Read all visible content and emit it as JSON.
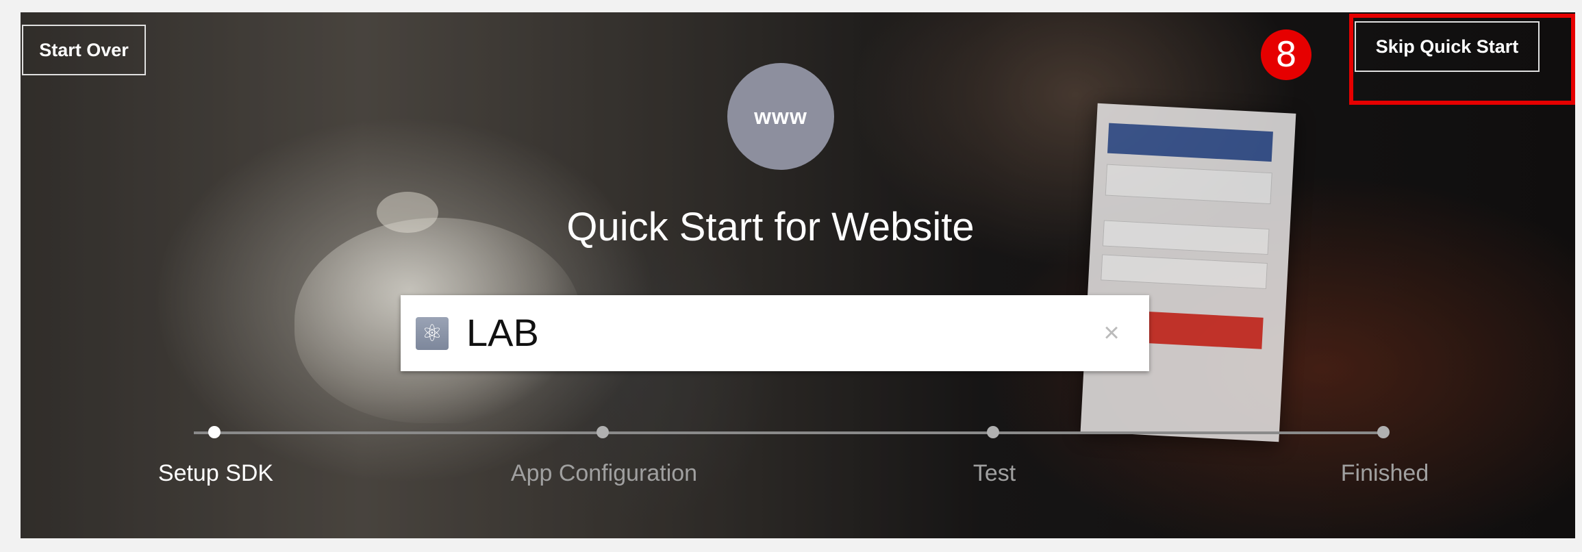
{
  "header": {
    "start_over_label": "Start Over",
    "skip_label": "Skip Quick Start",
    "step_badge": "8"
  },
  "hero": {
    "platform_icon_text": "www",
    "title": "Quick Start for Website"
  },
  "app_selector": {
    "app_name": "LAB",
    "app_icon": "atom-icon",
    "clear_icon": "×"
  },
  "steps": [
    {
      "label": "Setup SDK",
      "active": true
    },
    {
      "label": "App Configuration",
      "active": false
    },
    {
      "label": "Test",
      "active": false
    },
    {
      "label": "Finished",
      "active": false
    }
  ],
  "colors": {
    "highlight": "#e60000",
    "platform_circle": "#8d8f9e"
  }
}
